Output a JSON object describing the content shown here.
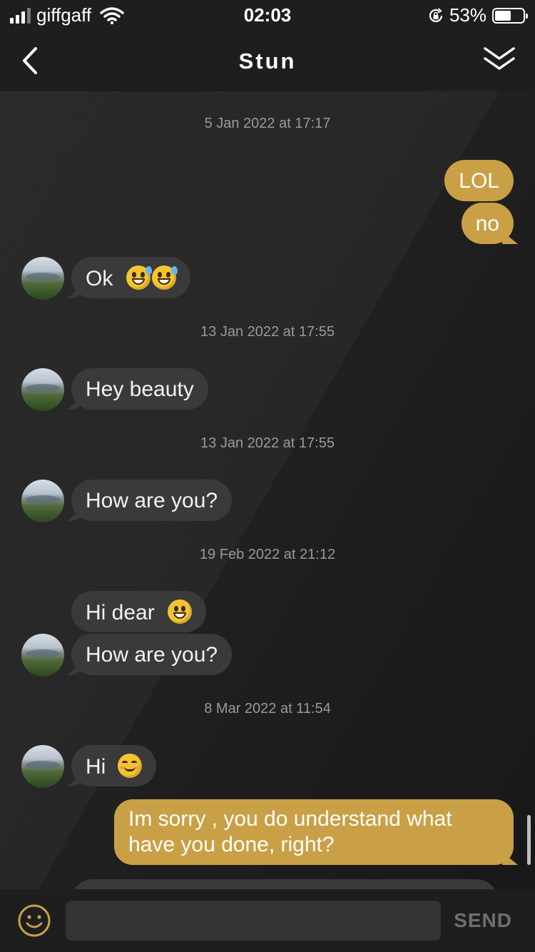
{
  "status_bar": {
    "carrier": "giffgaff",
    "time": "02:03",
    "battery_percent": "53%",
    "battery_level": 0.53
  },
  "header": {
    "title": "Stun",
    "back_icon": "chevron-left-icon",
    "collapse_icon": "double-chevron-down-icon"
  },
  "chat": {
    "timestamps": [
      "5 Jan 2022 at 17:17",
      "13 Jan 2022 at 17:55",
      "13 Jan 2022 at 17:55",
      "19 Feb 2022 at 21:12",
      "8 Mar 2022 at 11:54"
    ],
    "messages": [
      {
        "from": "me",
        "text": "LOL"
      },
      {
        "from": "me",
        "text": "no"
      },
      {
        "from": "Stun",
        "text": "Ok",
        "emoji": [
          "grinning-sweat-icon",
          "grinning-sweat-icon"
        ]
      },
      {
        "from": "Stun",
        "text": "Hey beauty"
      },
      {
        "from": "Stun",
        "text": "How are you?"
      },
      {
        "from": "Stun",
        "text": "Hi dear",
        "emoji": [
          "grinning-face-icon"
        ]
      },
      {
        "from": "Stun",
        "text": "How are you?"
      },
      {
        "from": "Stun",
        "text": "Hi",
        "emoji": [
          "smiling-blush-icon"
        ]
      },
      {
        "from": "me",
        "text": "Im sorry , you do understand what have you done, right?"
      }
    ]
  },
  "input": {
    "value": "",
    "placeholder": "",
    "send_label": "SEND"
  },
  "colors": {
    "sent_bubble": "#c9a045",
    "received_bubble": "#3a3a3a",
    "background": "#1c1c1c",
    "emoji_button": "#c9a045"
  }
}
